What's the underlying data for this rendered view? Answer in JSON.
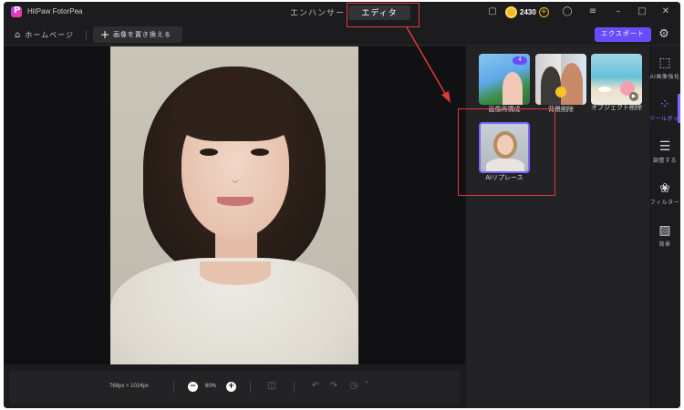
{
  "app": {
    "name": "HitPaw FotorPea"
  },
  "mode_tabs": [
    {
      "label": "エンハンサー"
    },
    {
      "label": "エディタ"
    }
  ],
  "credits": {
    "value": "2430"
  },
  "toolbar": {
    "home_label": "ホームページ",
    "replace_label": "画像を置き換える",
    "export_label": "エクスポート"
  },
  "canvas": {
    "dimensions": "768px × 1024px",
    "zoom": "60%"
  },
  "tools": [
    {
      "label": "画像再構成",
      "badge": "4"
    },
    {
      "label": "背景削除"
    },
    {
      "label": "オブジェクト削除"
    },
    {
      "label": "AIリプレース"
    }
  ],
  "rail": [
    {
      "label": "AI画像強化"
    },
    {
      "label": "ツールボックス"
    },
    {
      "label": "調整する"
    },
    {
      "label": "フィルター"
    },
    {
      "label": "背景"
    }
  ],
  "colors": {
    "accent": "#6a4cff",
    "highlight": "#e0393e"
  }
}
